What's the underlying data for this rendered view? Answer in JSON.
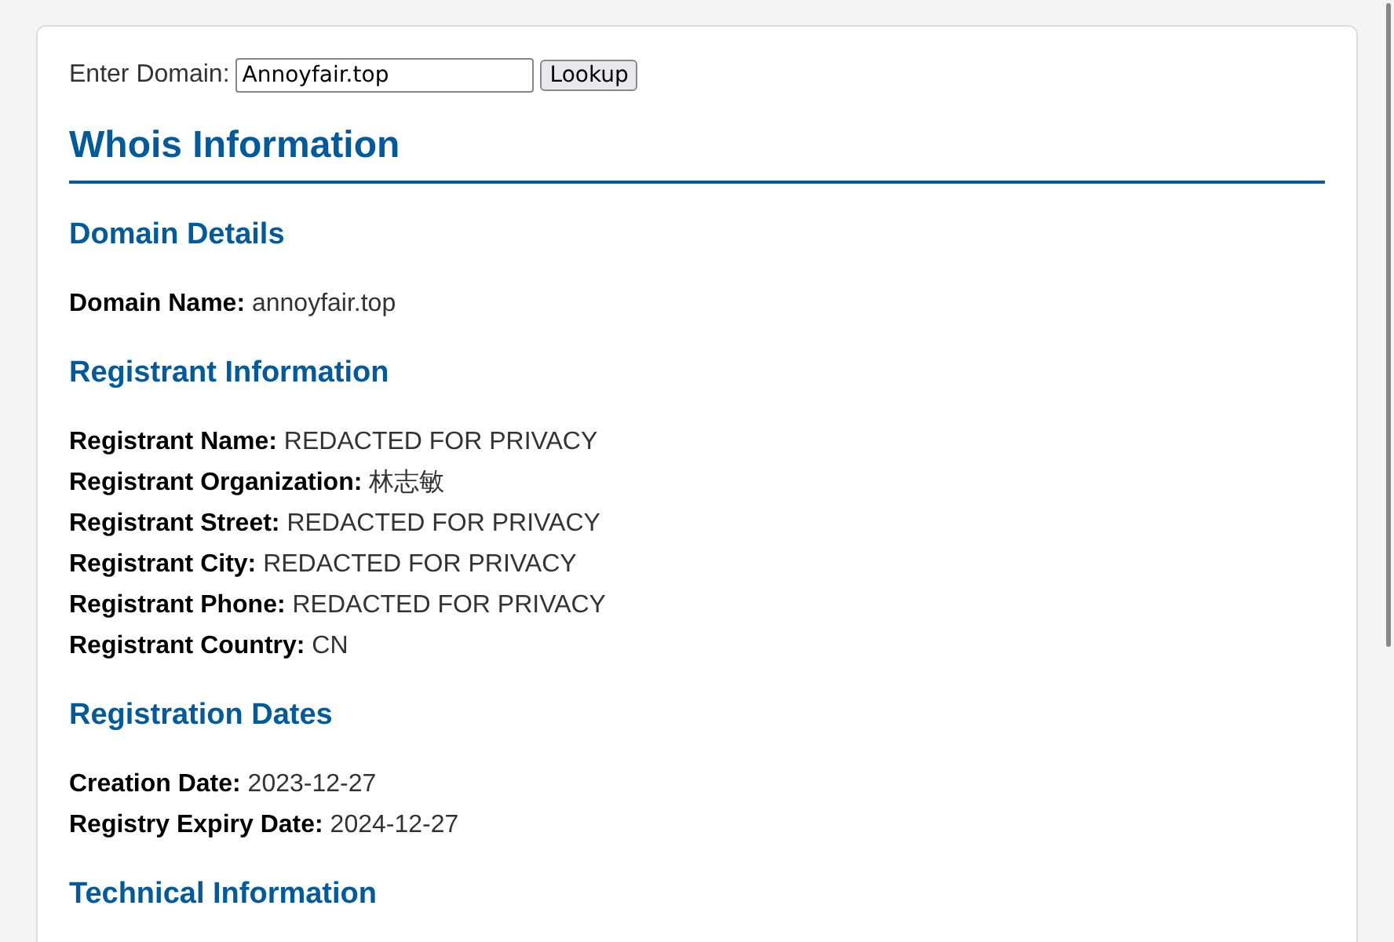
{
  "lookup": {
    "label": "Enter Domain:",
    "value": "Annoyfair.top",
    "button": "Lookup"
  },
  "title": "Whois Information",
  "sections": [
    {
      "title": "Domain Details",
      "fields": [
        {
          "label": "Domain Name:",
          "value": "annoyfair.top"
        }
      ]
    },
    {
      "title": "Registrant Information",
      "fields": [
        {
          "label": "Registrant Name:",
          "value": "REDACTED FOR PRIVACY"
        },
        {
          "label": "Registrant Organization:",
          "value": "林志敏"
        },
        {
          "label": "Registrant Street:",
          "value": "REDACTED FOR PRIVACY"
        },
        {
          "label": "Registrant City:",
          "value": "REDACTED FOR PRIVACY"
        },
        {
          "label": "Registrant Phone:",
          "value": "REDACTED FOR PRIVACY"
        },
        {
          "label": "Registrant Country:",
          "value": "CN"
        }
      ]
    },
    {
      "title": "Registration Dates",
      "fields": [
        {
          "label": "Creation Date:",
          "value": "2023-12-27"
        },
        {
          "label": "Registry Expiry Date:",
          "value": "2024-12-27"
        }
      ]
    },
    {
      "title": "Technical Information"
    }
  ]
}
